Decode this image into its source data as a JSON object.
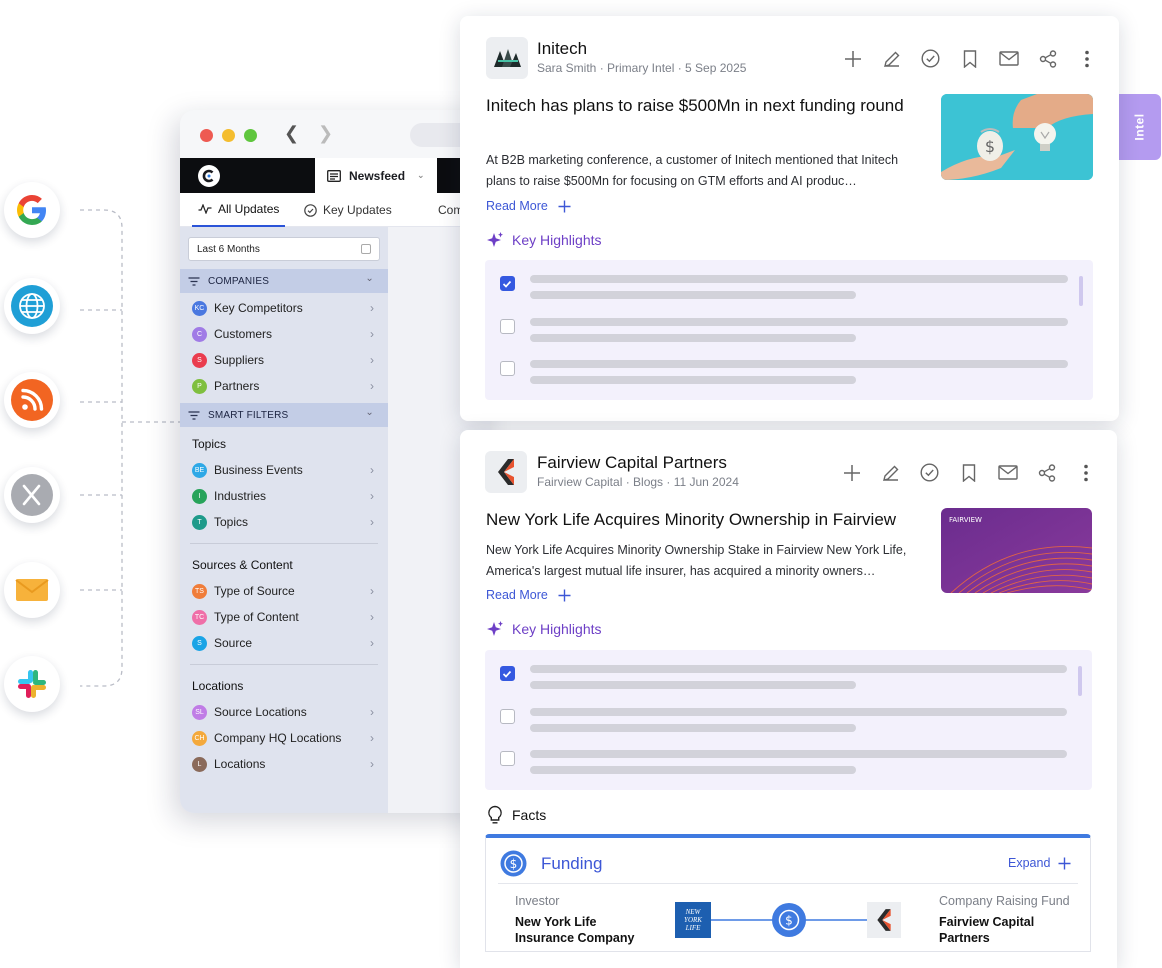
{
  "sources": {
    "icons": [
      "google-icon",
      "globe-icon",
      "rss-icon",
      "x-icon",
      "mail-icon",
      "slack-icon"
    ]
  },
  "browser": {
    "app_tab": "Newsfeed",
    "subtabs": [
      "All Updates",
      "Key Updates",
      "Com"
    ],
    "date_filter": "Last 6 Months",
    "companies_header": "COMPANIES",
    "companies": [
      {
        "badge": "KC",
        "label": "Key Competitors",
        "color": "#4a78e0"
      },
      {
        "badge": "C",
        "label": "Customers",
        "color": "#a07be6"
      },
      {
        "badge": "S",
        "label": "Suppliers",
        "color": "#ea3c4e"
      },
      {
        "badge": "P",
        "label": "Partners",
        "color": "#7fbf3f"
      }
    ],
    "smart_filters_header": "SMART FILTERS",
    "topics_title": "Topics",
    "topics": [
      {
        "badge": "BE",
        "label": "Business Events",
        "color": "#2ea8e6"
      },
      {
        "badge": "I",
        "label": "Industries",
        "color": "#27a35a"
      },
      {
        "badge": "T",
        "label": "Topics",
        "color": "#1e9a8a"
      }
    ],
    "sources_title": "Sources & Content",
    "sources": [
      {
        "badge": "TS",
        "label": "Type of Source",
        "color": "#f07d3a"
      },
      {
        "badge": "TC",
        "label": "Type of Content",
        "color": "#ef6fa8"
      },
      {
        "badge": "S",
        "label": "Source",
        "color": "#1aa4e6"
      }
    ],
    "locations_title": "Locations",
    "locations": [
      {
        "badge": "SL",
        "label": "Source Locations",
        "color": "#c07ce6"
      },
      {
        "badge": "CH",
        "label": "Company HQ Locations",
        "color": "#f4a93c"
      },
      {
        "badge": "L",
        "label": "Locations",
        "color": "#8a6a5a"
      }
    ]
  },
  "card1": {
    "company": "Initech",
    "meta": "Sara Smith · Primary Intel · 5 Sep 2025",
    "headline": "Initech has plans to raise $500Mn in next funding round",
    "body": "At B2B marketing conference, a customer of Initech mentioned that Initech plans to raise $500Mn for focusing on GTM efforts and AI produc…",
    "read_more": "Read More",
    "key_highlights": "Key Highlights",
    "checks": [
      true,
      false,
      false
    ]
  },
  "intel_tab": "Intel",
  "card2": {
    "company": "Fairview Capital Partners",
    "meta": "Fairview Capital · Blogs · 11 Jun 2024",
    "headline": "New York Life Acquires Minority Ownership in Fairview",
    "body": "New York Life Acquires Minority Ownership Stake in Fairview New York Life, America's largest mutual life insurer, has acquired a minority owners…",
    "image_label": "FAIRVIEW",
    "read_more": "Read More",
    "key_highlights": "Key Highlights",
    "checks": [
      true,
      false,
      false
    ],
    "facts_label": "Facts",
    "funding": {
      "title": "Funding",
      "expand": "Expand",
      "investor_label": "Investor",
      "investor_line1": "New York Life",
      "investor_line2": "Insurance Company",
      "investor_logo": "NEW YORK LIFE",
      "raiser_label": "Company Raising Fund",
      "raiser_line1": "Fairview Capital",
      "raiser_line2": "Partners"
    }
  },
  "colors": {
    "accent": "#3d57d6",
    "highlight_purple": "#6d3fc6",
    "intel_tab": "#b49bf0",
    "checkbox_on": "#3559e0"
  }
}
